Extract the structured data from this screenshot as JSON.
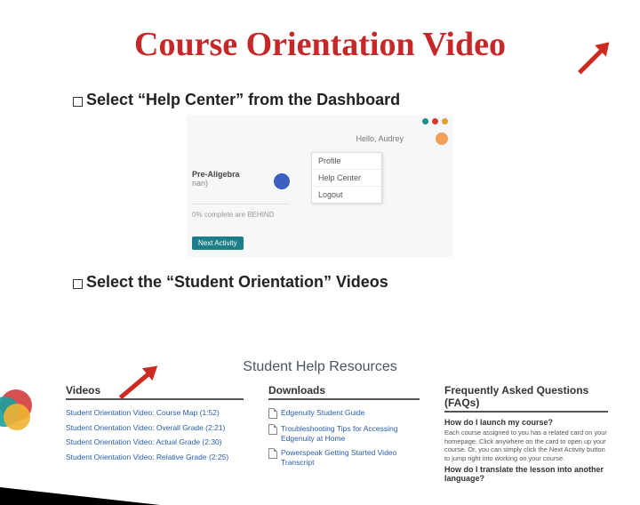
{
  "title": "Course Orientation Video",
  "bullets": {
    "b1_prefix": "Select ",
    "b1_rest": "“Help Center” from the Dashboard",
    "b2_prefix": "Select ",
    "b2_rest": "the “Student Orientation” Videos"
  },
  "shot1": {
    "greeting": "Hello, Audrey",
    "course_title": "Pre-Aligebra",
    "course_sub": "nan)",
    "behind": "0% complete are BEHIND",
    "next_btn": "Next Activity",
    "menu": {
      "profile": "Profile",
      "help": "Help Center",
      "logout": "Logout"
    }
  },
  "shot2": {
    "heading": "Student Help Resources",
    "col_videos": "Videos",
    "col_downloads": "Downloads",
    "col_faq": "Frequently Asked Questions (FAQs)",
    "v1": "Student Orientation Video: Course Map (1:52)",
    "v2": "Student Orientation Video: Overall Grade (2:21)",
    "v3": "Student Orientation Video: Actual Grade (2:30)",
    "v4": "Student Orientation Video: Relative Grade (2:25)",
    "d1": "Edgenuity Student Guide",
    "d2": "Troubleshooting Tips for Accessing Edgenuity at Home",
    "d3": "Powerspeak Getting Started Video Transcript",
    "faq_q1": "How do I launch my course?",
    "faq_a1": "Each course assigned to you has a related card on your homepage. Click anywhere on the card to open up your course. Or, you can simply click the Next Activity button to jump right into working on your course.",
    "faq_q2": "How do I translate the lesson into another language?"
  }
}
